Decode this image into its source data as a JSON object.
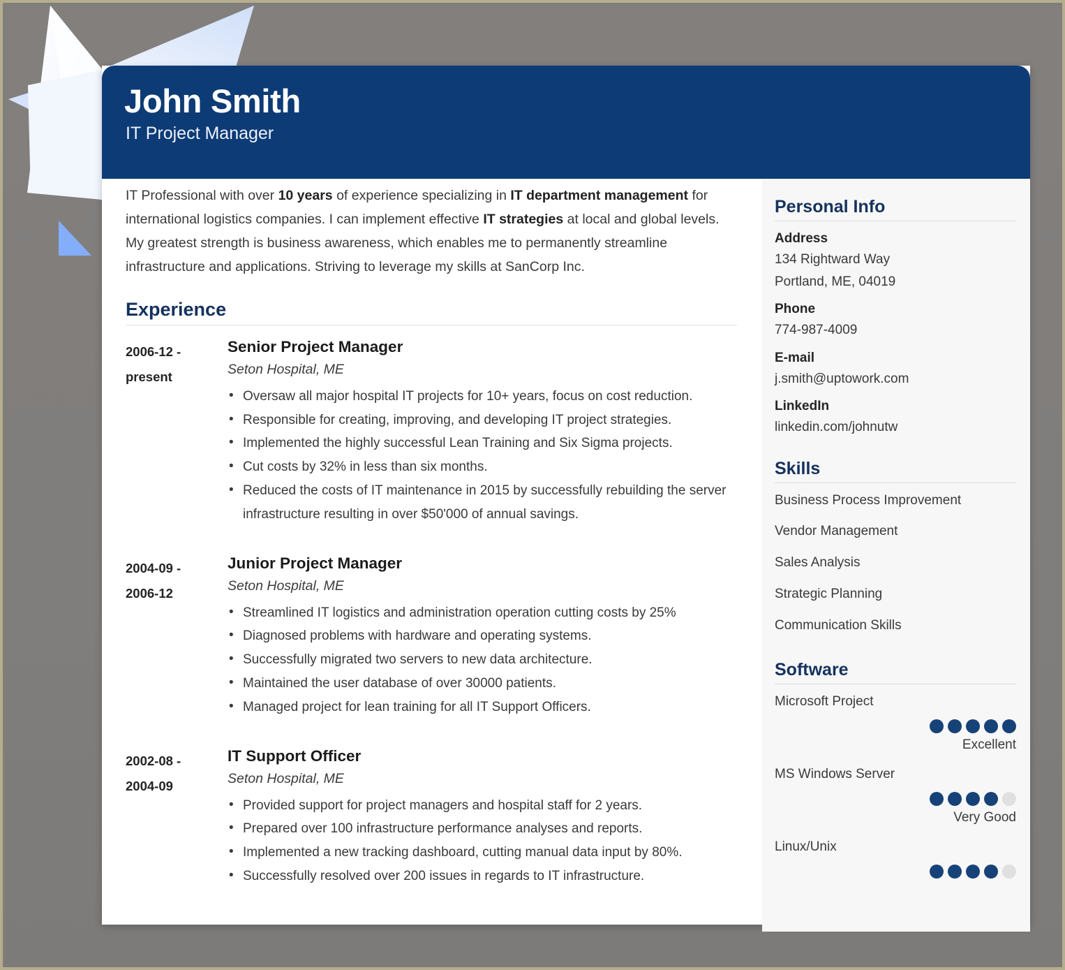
{
  "theme": {
    "navy": "#0d3b76",
    "heading_navy": "#15325e",
    "dot_on": "#164278",
    "dot_off": "#e0e0e0",
    "page_bg": "#807e7c",
    "sidebar_bg": "#f7f7f7"
  },
  "header": {
    "name": "John Smith",
    "title": "IT Project Manager"
  },
  "summary": {
    "parts": [
      {
        "text": "IT Professional with over ",
        "bold": false
      },
      {
        "text": "10 years",
        "bold": true
      },
      {
        "text": " of experience specializing in ",
        "bold": false
      },
      {
        "text": "IT department management",
        "bold": true
      },
      {
        "text": " for international logistics companies. I can implement effective ",
        "bold": false
      },
      {
        "text": "IT strategies",
        "bold": true
      },
      {
        "text": " at local and global levels. My greatest strength is business awareness, which enables me to permanently streamline infrastructure and applications. Striving to leverage my skills at SanCorp Inc.",
        "bold": false
      }
    ],
    "plain": "IT Professional with over 10 years of experience specializing in IT department management for international logistics companies. I can implement effective IT strategies at local and global levels. My greatest strength is business awareness, which enables me to permanently streamline infrastructure and applications. Striving to leverage my skills at SanCorp Inc."
  },
  "experience": {
    "heading": "Experience",
    "jobs": [
      {
        "dates": "2006-12 - present",
        "date_line1": "2006-12 -",
        "date_line2": "present",
        "role": "Senior Project Manager",
        "company": "Seton Hospital, ME",
        "bullets": [
          "Oversaw all major hospital IT projects for 10+ years, focus on cost reduction.",
          "Responsible for creating, improving, and developing IT project strategies.",
          "Implemented the highly successful Lean Training and Six Sigma projects.",
          "Cut costs by 32% in less than six months.",
          "Reduced the costs of IT maintenance in 2015 by successfully rebuilding the server infrastructure resulting in over $50'000 of annual savings."
        ]
      },
      {
        "dates": "2004-09 - 2006-12",
        "date_line1": "2004-09 -",
        "date_line2": "2006-12",
        "role": "Junior Project Manager",
        "company": "Seton Hospital, ME",
        "bullets": [
          "Streamlined IT logistics and administration operation cutting costs by 25%",
          "Diagnosed problems with hardware and operating systems.",
          "Successfully migrated two servers to new data architecture.",
          "Maintained the user database of over 30000 patients.",
          "Managed project for lean training for all IT Support Officers."
        ]
      },
      {
        "dates": "2002-08 - 2004-09",
        "date_line1": "2002-08 -",
        "date_line2": "2004-09",
        "role": "IT Support Officer",
        "company": "Seton Hospital, ME",
        "bullets": [
          "Provided support for project managers and hospital staff for 2 years.",
          "Prepared over 100 infrastructure performance analyses and reports.",
          "Implemented a new tracking dashboard, cutting manual data input by 80%.",
          "Successfully resolved over 200 issues in regards to IT infrastructure."
        ]
      }
    ]
  },
  "personal_info": {
    "heading": "Personal Info",
    "address_label": "Address",
    "address_line1": "134 Rightward Way",
    "address_line2": "Portland, ME, 04019",
    "phone_label": "Phone",
    "phone_value": "774-987-4009",
    "email_label": "E-mail",
    "email_value": "j.smith@uptowork.com",
    "linkedin_label": "LinkedIn",
    "linkedin_value": "linkedin.com/johnutw"
  },
  "skills": {
    "heading": "Skills",
    "items": [
      "Business Process Improvement",
      "Vendor Management",
      "Sales Analysis",
      "Strategic Planning",
      "Communication Skills"
    ]
  },
  "software": {
    "heading": "Software",
    "max_dots": 5,
    "items": [
      {
        "name": "Microsoft Project",
        "rating": 5,
        "level": "Excellent"
      },
      {
        "name": "MS Windows Server",
        "rating": 4,
        "level": "Very Good"
      },
      {
        "name": "Linux/Unix",
        "rating": 4,
        "level": ""
      }
    ]
  }
}
